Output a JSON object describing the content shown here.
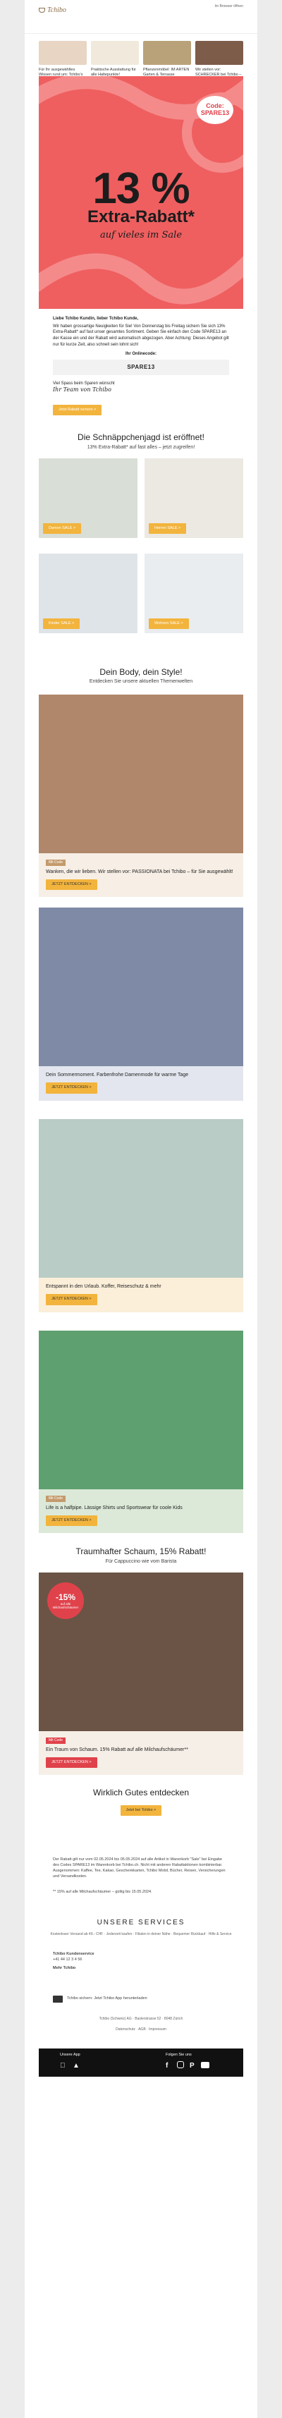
{
  "header": {
    "logo_text": "Tchibo",
    "browser_link": "Im Browser öffnen"
  },
  "categories": [
    {
      "label": "Für Ihr ausgewähltes Wissen rund um: Tchibo’s Ideen für Tchibo",
      "color": "#e8d5c4"
    },
    {
      "label": "Praktische Ausstattung für alle Haltepunkte!",
      "color": "#f1e9dc"
    },
    {
      "label": "Pflanzenmöbel: IM ARTEN Garten & Terrasse",
      "color": "#b9a27a"
    },
    {
      "label": "Wir stellen vor: SCHRECKER bei Tchibo – für Sie ausgewählt!",
      "color": "#7d5c4a"
    }
  ],
  "hero": {
    "code_label": "Code:",
    "code": "SPARE13",
    "percent": "13 %",
    "extra": "Extra-Rabatt*",
    "subtitle": "auf vieles im Sale",
    "bg_color": "#ef5f60"
  },
  "intro": {
    "greeting": "Liebe Tchibo Kundin, lieber Tchibo Kunde,",
    "body": "Wir haben grossartige Neuigkeiten für Sie! Von Donnerstag bis Freitag sichern Sie sich 13% Extra-Rabatt* auf fast unser gesamtes Sortiment. Geben Sie einfach den Code SPARE13 an der Kasse ein und der Rabatt wird automatisch abgezogen. Aber Achtung: Dieses Angebot gilt nur für kurze Zeit, also schnell sein lohnt sich!",
    "online_label": "Ihr Onlinecode:",
    "code": "SPARE13",
    "closing": "Viel Spass beim Sparen wünscht",
    "signature": "Ihr Team von Tchibo",
    "button": "Jetzt Rabatt sichern >"
  },
  "sale": {
    "title": "Die Schnäppchenjagd ist eröffnet!",
    "subtitle": "13% Extra-Rabatt* auf fast alles – jetzt zugreifen!",
    "tiles": [
      {
        "label": "Damen SALE >",
        "color": "#d9ded6"
      },
      {
        "label": "Herren SALE >",
        "color": "#ece9e2"
      },
      {
        "label": "Kinder SALE >",
        "color": "#dfe4e8"
      },
      {
        "label": "Wohnen SALE >",
        "color": "#e9edf0"
      }
    ]
  },
  "body_section": {
    "title": "Dein Body, dein Style!",
    "subtitle": "Entdecken Sie unsere aktuellen Themenwelten"
  },
  "features": [
    {
      "tag": "Mit Code",
      "text": "Wanken, die wir lieben. Wir stellen vor: PASSIONATA bei Tchibo – für Sie ausgewählt!",
      "button": "JETZT ENTDECKEN >",
      "color": "#b0876b",
      "panel": "#f7efe6"
    },
    {
      "tag": "",
      "text": "Dein Sommermoment. Farbenfrohe Damenmode für warme Tage",
      "button": "JETZT ENTDECKEN >",
      "color": "#7f8aa6",
      "panel": "#e3e6ee"
    },
    {
      "tag": "",
      "text": "Entspannt in den Urlaub. Koffer, Reiseschutz & mehr",
      "button": "JETZT ENTDECKEN >",
      "color": "#b9ccc6",
      "panel": "#fbefd9"
    },
    {
      "tag": "Mit Code",
      "text": "Life is a halfpipe. Lässige Shirts und Sportswear für coole Kids",
      "button": "JETZT ENTDECKEN >",
      "color": "#5fa070",
      "panel": "#dce9d8"
    }
  ],
  "foam": {
    "title": "Traumhafter Schaum, 15% Rabatt!",
    "subtitle": "Für Cappuccino wie vom Barista",
    "badge_percent": "-15%",
    "badge_text": "auf alle Milchaufschäumer",
    "tag": "Mit Code",
    "text": "Ein Traum von Schaum. 15% Rabatt auf alle Milchaufschäumer**",
    "button": "JETZT ENTDECKEN >",
    "color": "#6b5446"
  },
  "more": {
    "title": "Wirklich Gutes entdecken",
    "button": "Jetzt bei Tchibo >"
  },
  "legal": {
    "text1": "Der Rabatt gilt nur vom 02.05.2024 bis 05.05.2024 auf alle Artikel in Warenkorb \"Sale\" bei Eingabe des Codes SPARE13 im Warenkorb bei Tchibo.ch. Nicht mit anderen Rabattaktionen kombinierbar. Ausgenommen: Kaffee, Tee, Kakao, Geschenkkarten, Tchibo Mobil, Bücher, Reisen, Versicherungen und Versandkosten.",
    "text2": "** 15% auf alle Milchaufschäumer – gültig bis 15.05.2024."
  },
  "services": {
    "title": "UNSERE SERVICES",
    "line": "Kostenloser Versand ab 49.- CHF · Jederzeit kaufen · Filialen in deiner Nähe · Bequemer Rückkauf · Hilfe & Service",
    "contact_title": "Tchibo Kundenservice",
    "phone": "+41 44 12 3 4 56",
    "extra": "Mehr Tchibo",
    "app_text": "Tchibo sichern: Jetzt Tchibo App herunterladen"
  },
  "footer": {
    "address": "Tchibo (Schweiz) AG · Baslerstrasse 52 · 8048 Zürich",
    "links": "Datenschutz · AGB · Impressum",
    "app_label": "Unsere App",
    "follow_label": "Folgen Sie uns"
  }
}
